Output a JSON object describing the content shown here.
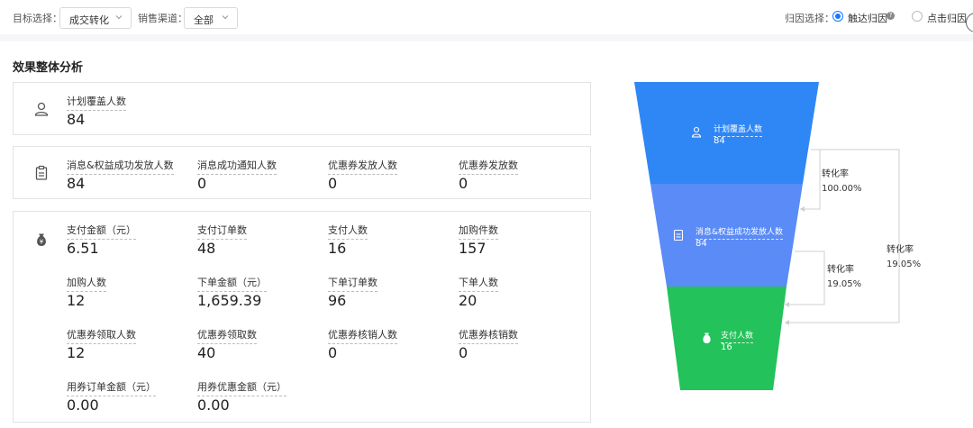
{
  "filters": {
    "goal_label": "目标选择：",
    "goal_value": "成交转化",
    "channel_label": "销售渠道：",
    "channel_value": "全部",
    "attribution_label": "归因选择：",
    "attribution_options": [
      {
        "label": "触达归因",
        "selected": true
      },
      {
        "label": "点击归因",
        "selected": false
      }
    ]
  },
  "section_title": "效果整体分析",
  "cards": {
    "coverage": {
      "icon": "user-icon",
      "metrics": [
        {
          "label": "计划覆盖人数",
          "value": "84"
        }
      ]
    },
    "issuance": {
      "icon": "clipboard-icon",
      "metrics": [
        {
          "label": "消息&权益成功发放人数",
          "value": "84"
        },
        {
          "label": "消息成功通知人数",
          "value": "0"
        },
        {
          "label": "优惠券发放人数",
          "value": "0"
        },
        {
          "label": "优惠券发放数",
          "value": "0"
        }
      ]
    },
    "payment": {
      "icon": "money-bag-icon",
      "metrics": [
        {
          "label": "支付金额（元）",
          "value": "6.51"
        },
        {
          "label": "支付订单数",
          "value": "48"
        },
        {
          "label": "支付人数",
          "value": "16"
        },
        {
          "label": "加购件数",
          "value": "157"
        },
        {
          "label": "加购人数",
          "value": "12"
        },
        {
          "label": "下单金额（元）",
          "value": "1,659.39"
        },
        {
          "label": "下单订单数",
          "value": "96"
        },
        {
          "label": "下单人数",
          "value": "20"
        },
        {
          "label": "优惠券领取人数",
          "value": "12"
        },
        {
          "label": "优惠券领取数",
          "value": "40"
        },
        {
          "label": "优惠券核销人数",
          "value": "0"
        },
        {
          "label": "优惠券核销数",
          "value": "0"
        },
        {
          "label": "用券订单金额（元）",
          "value": "0.00"
        },
        {
          "label": "用券优惠金额（元）",
          "value": "0.00"
        }
      ]
    }
  },
  "funnel": {
    "stages": [
      {
        "label": "计划覆盖人数",
        "value": "84",
        "icon": "user-icon",
        "color": "#2f87f6"
      },
      {
        "label": "消息&权益成功发放人数",
        "value": "84",
        "icon": "clipboard-icon",
        "color": "#5a8bf7"
      },
      {
        "label": "支付人数",
        "value": "16",
        "icon": "money-bag-icon",
        "color": "#23c25a"
      }
    ],
    "conversions": [
      {
        "label": "转化率",
        "value": "100.00%"
      },
      {
        "label": "转化率",
        "value": "19.05%"
      },
      {
        "label": "转化率",
        "value": "19.05%"
      }
    ]
  }
}
